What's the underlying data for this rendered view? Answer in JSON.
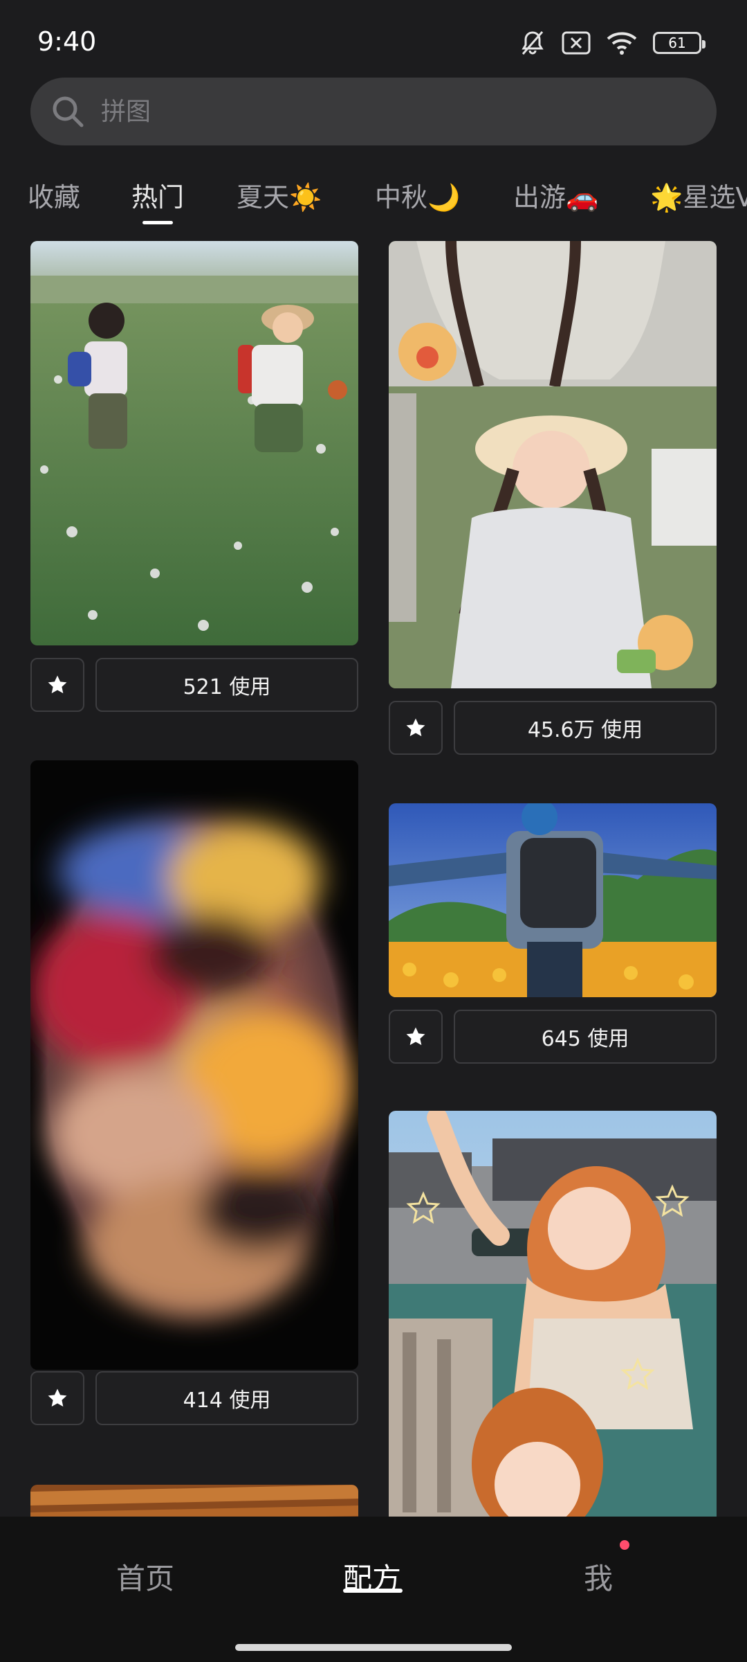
{
  "status_bar": {
    "time": "9:40",
    "battery_level": "61",
    "icons": [
      "bell-muted-icon",
      "sim-off-icon",
      "wifi-icon",
      "battery-icon"
    ]
  },
  "search": {
    "placeholder": "拼图"
  },
  "tabs": [
    {
      "label": "收藏",
      "active": false
    },
    {
      "label": "热门",
      "active": true
    },
    {
      "label": "夏天☀️",
      "active": false
    },
    {
      "label": "中秋🌙",
      "active": false
    },
    {
      "label": "出游🚗",
      "active": false
    },
    {
      "label": "🌟星选V",
      "active": false
    }
  ],
  "cards": [
    {
      "usage": "521 使用",
      "image": "children-in-flower-field"
    },
    {
      "usage": "45.6万 使用",
      "image": "girl-in-straw-hat-collage"
    },
    {
      "usage": "414 使用",
      "image": "blurred-circular-portrait"
    },
    {
      "usage": "645 使用",
      "image": "hiker-in-flower-meadow"
    },
    {
      "usage": "",
      "image": "water-town-portrait"
    }
  ],
  "bottom_nav": {
    "items": [
      {
        "label": "首页",
        "active": false
      },
      {
        "label": "配方",
        "active": true
      },
      {
        "label": "我",
        "active": false,
        "badge": true
      }
    ]
  },
  "colors": {
    "background": "#1c1c1e",
    "search_bg": "#3a3a3c",
    "nav_bg": "#121212",
    "badge": "#ff4d6d"
  }
}
